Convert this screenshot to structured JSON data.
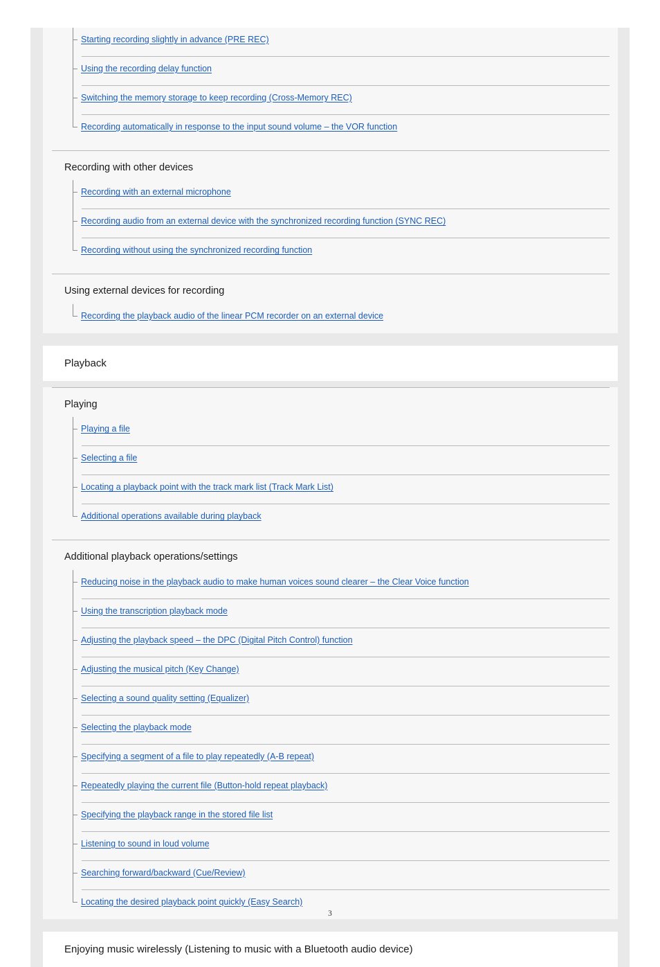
{
  "document": {
    "page_number": "3"
  },
  "toc": {
    "blocks": [
      {
        "kind": "group",
        "leading_items": [
          {
            "label": "Starting recording slightly in advance (PRE REC)"
          },
          {
            "label": "Using the recording delay function"
          },
          {
            "label": "Switching the memory storage to keep recording (Cross-Memory REC)"
          },
          {
            "label": "Recording automatically in response to the input sound volume – the VOR function"
          }
        ],
        "sections": [
          {
            "title": "Recording with other devices",
            "items": [
              {
                "label": "Recording with an external microphone"
              },
              {
                "label": "Recording audio from an external device with the synchronized recording function (SYNC REC)"
              },
              {
                "label": "Recording without using the synchronized recording function"
              }
            ]
          },
          {
            "title": "Using external devices for recording",
            "items": [
              {
                "label": "Recording the playback audio of the linear PCM recorder on an external device"
              }
            ]
          }
        ]
      },
      {
        "kind": "chapter",
        "title": "Playback"
      },
      {
        "kind": "group",
        "leading_items": [],
        "sections": [
          {
            "title": "Playing",
            "items": [
              {
                "label": "Playing a file"
              },
              {
                "label": "Selecting a file"
              },
              {
                "label": "Locating a playback point with the track mark list (Track Mark List)"
              },
              {
                "label": "Additional operations available during playback"
              }
            ]
          },
          {
            "title": "Additional playback operations/settings",
            "items": [
              {
                "label": "Reducing noise in the playback audio to make human voices sound clearer – the Clear Voice function"
              },
              {
                "label": "Using the transcription playback mode"
              },
              {
                "label": "Adjusting the playback speed – the DPC (Digital Pitch Control) function"
              },
              {
                "label": "Adjusting the musical pitch (Key Change)"
              },
              {
                "label": "Selecting a sound quality setting (Equalizer)"
              },
              {
                "label": "Selecting the playback mode"
              },
              {
                "label": "Specifying a segment of a file to play repeatedly (A-B repeat)"
              },
              {
                "label": "Repeatedly playing the current file (Button-hold repeat playback)"
              },
              {
                "label": "Specifying the playback range in the stored file list"
              },
              {
                "label": "Listening to sound in loud volume"
              },
              {
                "label": "Searching forward/backward (Cue/Review)"
              },
              {
                "label": "Locating the desired playback point quickly (Easy Search)"
              }
            ]
          }
        ]
      },
      {
        "kind": "chapter",
        "title": "Enjoying music wirelessly (Listening to music with a Bluetooth audio device)"
      }
    ]
  },
  "colors": {
    "link": "#1a5cb8",
    "text": "#1a1a1a",
    "group_bg": "#f7f7f7",
    "frame_bg": "#e9e9e9",
    "chapter_bg": "#ffffff",
    "rule": "#b9b9b9",
    "spine": "#8c8c8c"
  }
}
